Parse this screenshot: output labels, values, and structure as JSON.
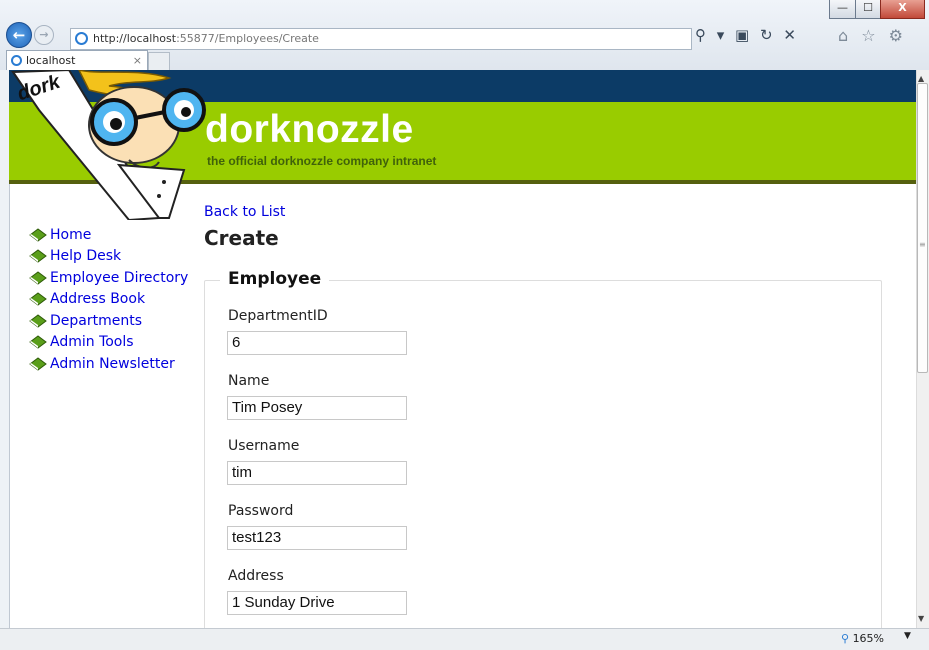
{
  "browser": {
    "url_host": "http://localhost",
    "url_rest": ":55877/Employees/Create",
    "tab_title": "localhost",
    "tab_close": "×",
    "window_buttons": {
      "minimize": "—",
      "maximize": "☐",
      "close": "X"
    },
    "back_glyph": "←",
    "forward_glyph": "→",
    "address_tools": "⚲ ▾ ▣ ↻ ✕",
    "right_icons": "⌂ ☆ ⚙",
    "zoom": "165%",
    "zoom_caret": "▼"
  },
  "site": {
    "brand": "dorknozzle",
    "tagline": "the official dorknozzle company intranet",
    "mascot_sign": "dork",
    "nav": [
      {
        "label": "Home"
      },
      {
        "label": "Help Desk"
      },
      {
        "label": "Employee Directory"
      },
      {
        "label": "Address Book"
      },
      {
        "label": "Departments"
      },
      {
        "label": "Admin Tools"
      },
      {
        "label": "Admin Newsletter"
      }
    ]
  },
  "main": {
    "back_link": "Back to List",
    "title": "Create",
    "fieldset_legend": "Employee",
    "fields": [
      {
        "label": "DepartmentID",
        "value": "6"
      },
      {
        "label": "Name",
        "value": "Tim Posey"
      },
      {
        "label": "Username",
        "value": "tim"
      },
      {
        "label": "Password",
        "value": "test123"
      },
      {
        "label": "Address",
        "value": "1 Sunday Drive"
      }
    ]
  },
  "colors": {
    "header_navy": "#0c3b66",
    "header_green": "#99cc00",
    "link_blue": "#0000dd"
  },
  "icons": [
    "back-arrow-icon",
    "forward-arrow-icon",
    "ie-page-icon",
    "search-icon",
    "refresh-icon",
    "stop-icon",
    "home-icon",
    "favorites-star-icon",
    "settings-gear-icon",
    "green-book-icon",
    "zoom-icon"
  ]
}
